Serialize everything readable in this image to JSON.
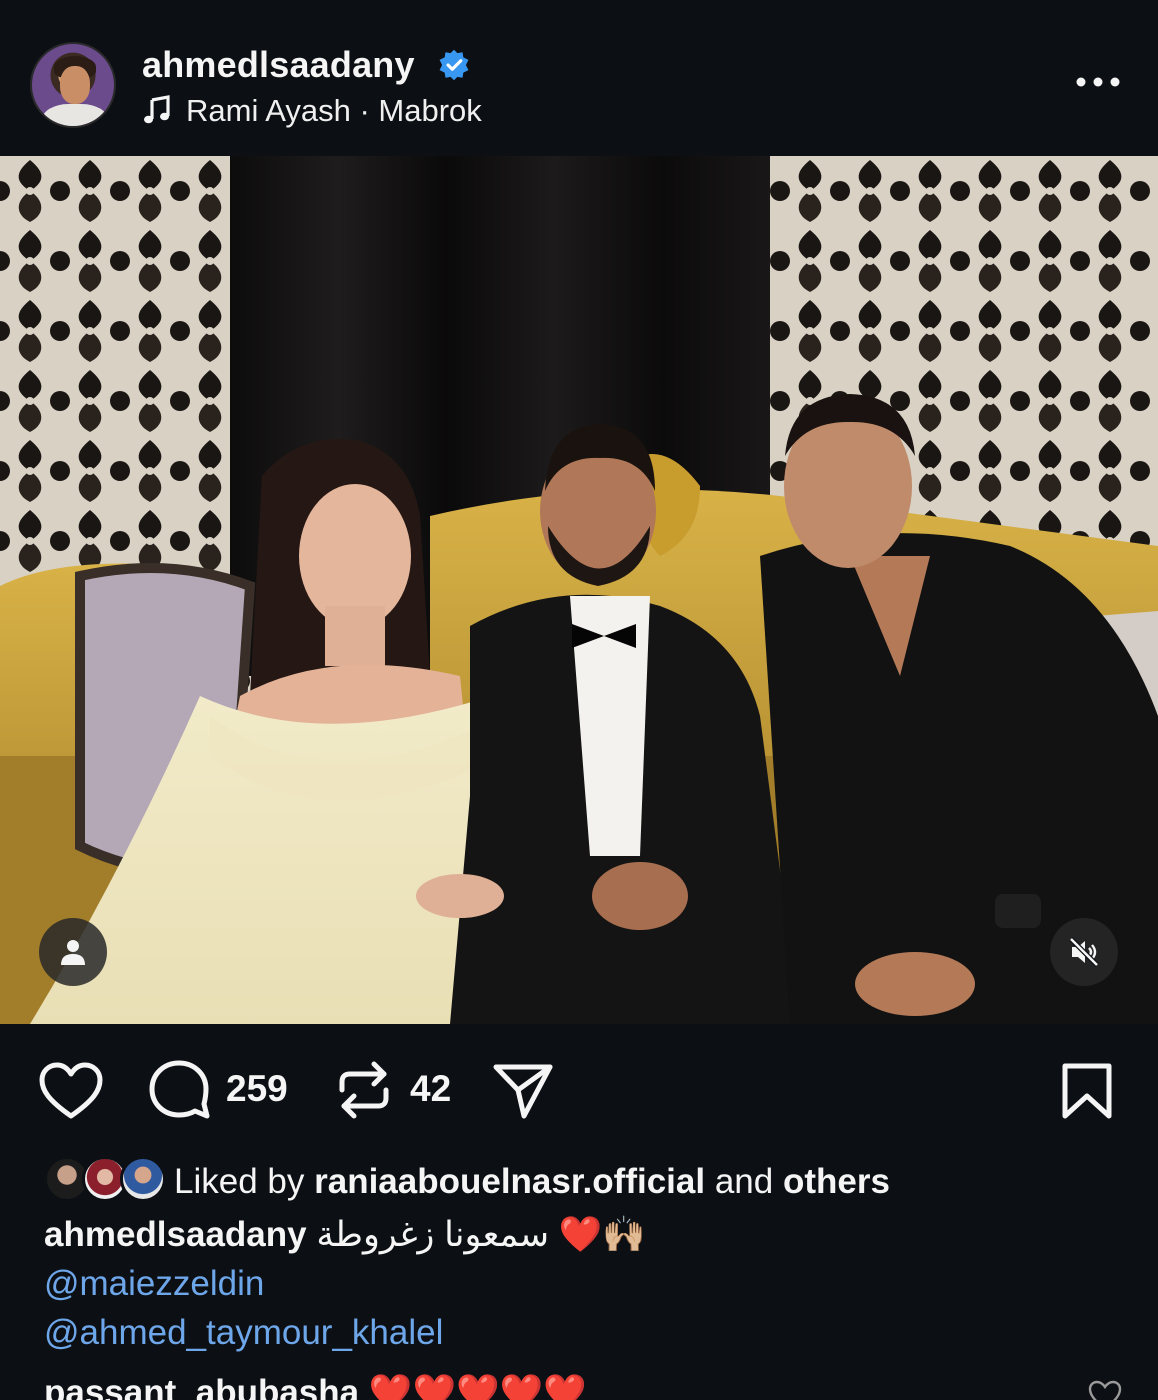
{
  "header": {
    "username": "ahmedlsaadany",
    "verified": true,
    "music": "Rami Ayash · Mabrok",
    "icons": [
      "music-note-icon",
      "verified-badge-icon",
      "more-options-icon"
    ]
  },
  "actions": {
    "comments_count": "259",
    "reposts_count": "42",
    "icons": [
      "heart-icon",
      "comment-icon",
      "repost-icon",
      "share-icon",
      "bookmark-icon"
    ]
  },
  "likes": {
    "prefix": "Liked by",
    "user": "raniaabouelnasr.official",
    "connector": "and",
    "others": "others"
  },
  "caption": {
    "username": "ahmedlsaadany",
    "text": "سمعونا زغروطة ❤️🙌🏼",
    "mentions": [
      "@maiezzeldin",
      "@ahmed_taymour_khalel"
    ]
  },
  "comment": {
    "username": "passant_abubasha",
    "text": "❤️❤️❤️❤️❤️"
  },
  "colors": {
    "background": "#0c1014",
    "text": "#f5f5f5",
    "mention": "#6ea6ea",
    "verified": "#3897f0"
  }
}
